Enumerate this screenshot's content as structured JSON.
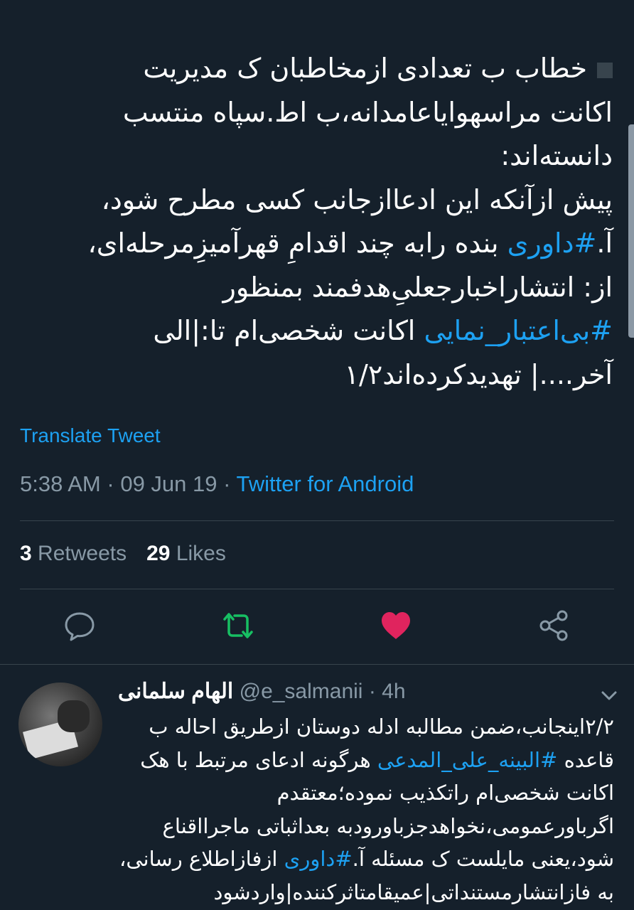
{
  "tweet": {
    "lines": [
      {
        "pre": "خطاب ب تعدادی ازمخاطبان ک مدیریت",
        "tag": "",
        "post": ""
      },
      {
        "pre": "اکانت مراسهوایاعامدانه،ب اط.سپاه منتسب",
        "tag": "",
        "post": ""
      },
      {
        "pre": "دانسته‌اند:",
        "tag": "",
        "post": ""
      },
      {
        "pre": "پیش ازآنکه این ادعاازجانب کسی مطرح شود،",
        "tag": "",
        "post": ""
      },
      {
        "pre": "آ.",
        "tag": "#داوری",
        "post": " بنده رابه چند اقدامِ قهرآمیزِمرحله‌ای،"
      },
      {
        "pre": "از: انتشاراخبارجعلیِ‌هدفمند بمنظور",
        "tag": "",
        "post": ""
      },
      {
        "pre": "",
        "tag": "#بی‌اعتبار_نمایی",
        "post": " اکانت شخصی‌ام تا:|الی"
      },
      {
        "pre": "آخر....| تهدیدکرده‌اند۱/۲",
        "tag": "",
        "post": ""
      }
    ],
    "translate_label": "Translate Tweet",
    "time": "5:38 AM",
    "date": "09 Jun 19",
    "separator": "·",
    "source": "Twitter for Android",
    "retweets_count": "3",
    "retweets_label": "Retweets",
    "likes_count": "29",
    "likes_label": "Likes"
  },
  "icons": {
    "reply": "reply-icon",
    "retweet": "retweet-icon",
    "like": "heart-icon",
    "share": "share-icon",
    "more": "chevron-down-icon"
  },
  "colors": {
    "background": "#15202b",
    "accent": "#1da1f2",
    "secondary_text": "#8899a6",
    "retweet_active": "#17bf63",
    "like_active": "#e0245e",
    "divider": "#38444d"
  },
  "reply": {
    "name": "الهام سلمانی",
    "handle": "@e_salmanii",
    "separator": "·",
    "time": "4h",
    "lines": [
      {
        "pre": "۲/۲اینجانب،ضمن مطالبه ادله دوستان ازطریق احاله ب",
        "tag": "",
        "post": ""
      },
      {
        "pre": "قاعده ",
        "tag": "#البینه_علی_المدعی",
        "post": " هرگونه ادعای مرتبط با هک"
      },
      {
        "pre": "اکانت شخصی‌ام راتکذیب نموده؛معتقدم",
        "tag": "",
        "post": ""
      },
      {
        "pre": "اگرباورعمومی،نخواهدجزباورودبه بعداثباتی ماجرااقناع",
        "tag": "",
        "post": ""
      },
      {
        "pre": "شود،یعنی مایلست ک مسئله آ.",
        "tag": "#داوری",
        "post": " ازفازاطلاع رسانی،"
      },
      {
        "pre": "به فازانتشارمستنداتی|عمیقامتاثرکننده|واردشود",
        "tag": "",
        "post": ""
      }
    ]
  }
}
